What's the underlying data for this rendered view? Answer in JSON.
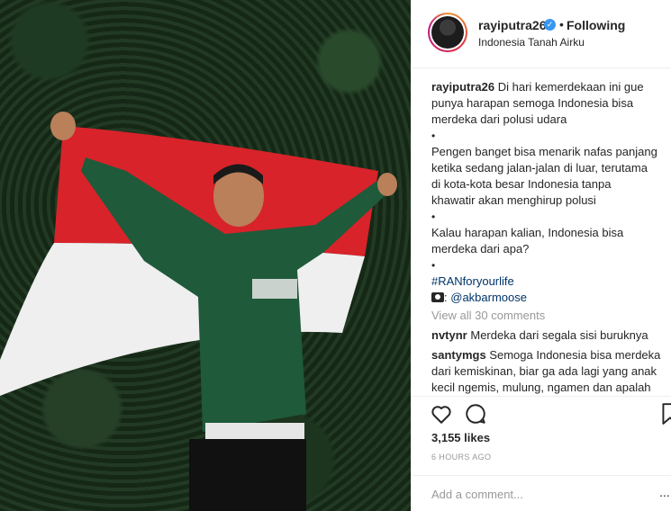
{
  "post": {
    "username": "rayiputra26",
    "separator": "•",
    "follow_status": "Following",
    "location": "Indonesia Tanah Airku",
    "verified_icon": "verified-badge-icon"
  },
  "caption": {
    "username": "rayiputra26",
    "lines": [
      "Di hari kemerdekaan ini gue",
      "punya harapan semoga Indonesia bisa",
      "merdeka dari polusi udara"
    ],
    "bullet": "•",
    "paragraph2": [
      "Pengen banget bisa menarik nafas panjang",
      "ketika sedang jalan-jalan di luar, terutama",
      "di kota-kota besar Indonesia tanpa",
      "khawatir akan menghirup polusi"
    ],
    "paragraph3": [
      "Kalau harapan kalian, Indonesia bisa",
      "merdeka dari apa?"
    ],
    "hashtag": "#RANforyourlife",
    "photo_credit_prefix": ":",
    "photo_credit_mention": "@akbarmoose"
  },
  "comments": {
    "view_all": "View all 30 comments",
    "items": [
      {
        "user": "nvtynr",
        "text": "Merdeka dari segala sisi buruknya"
      },
      {
        "user": "santymgs",
        "text": "Semoga Indonesia bisa merdeka dari kemiskinan, biar ga ada lagi yang anak kecil ngemis, mulung, ngamen dan apalah"
      }
    ]
  },
  "stats": {
    "likes": "3,155 likes",
    "time_ago": "6 HOURS AGO"
  },
  "compose": {
    "placeholder": "Add a comment...",
    "more_label": "..."
  },
  "colors": {
    "link": "#003569",
    "verified": "#3897f0",
    "flag_red": "#d8232a",
    "flag_white": "#f2f2f2",
    "hoodie": "#1f5a3a"
  }
}
